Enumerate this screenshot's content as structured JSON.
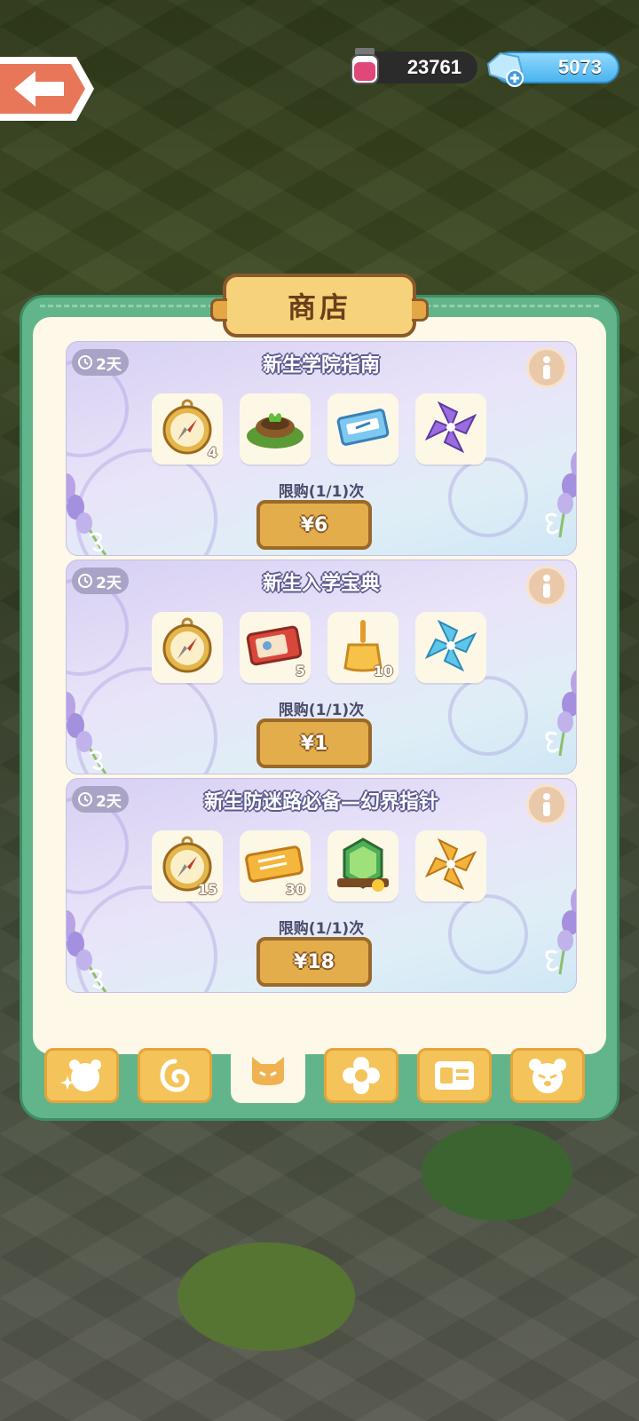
{
  "currencies": {
    "jam": {
      "value": "23761",
      "icon": "jam-jar-icon"
    },
    "gems": {
      "value": "5073",
      "icon": "crystal-icon"
    }
  },
  "shop": {
    "title": "商店",
    "packs": [
      {
        "timer": "2天",
        "title": "新生学院指南",
        "items": [
          {
            "icon": "golden-compass-icon",
            "qty": "4"
          },
          {
            "icon": "plant-pot-icon",
            "qty": ""
          },
          {
            "icon": "blue-ticket-icon",
            "qty": ""
          },
          {
            "icon": "purple-pinwheel-icon",
            "qty": ""
          }
        ],
        "limit": "限购(1/1)次",
        "price": "¥6"
      },
      {
        "timer": "2天",
        "title": "新生入学宝典",
        "items": [
          {
            "icon": "golden-compass-icon",
            "qty": ""
          },
          {
            "icon": "coupon-icon",
            "qty": "5"
          },
          {
            "icon": "brush-icon",
            "qty": "10"
          },
          {
            "icon": "blue-pinwheel-icon",
            "qty": ""
          }
        ],
        "limit": "限购(1/1)次",
        "price": "¥1"
      },
      {
        "timer": "2天",
        "title": "新生防迷路必备—幻界指针",
        "items": [
          {
            "icon": "golden-compass-icon",
            "qty": "15"
          },
          {
            "icon": "gold-ticket-icon",
            "qty": "30"
          },
          {
            "icon": "green-machine-icon",
            "qty": ""
          },
          {
            "icon": "golden-pinwheel-icon",
            "qty": ""
          }
        ],
        "limit": "限购(1/1)次",
        "price": "¥18"
      }
    ]
  },
  "tabs": [
    {
      "icon": "sparkle-bear-icon",
      "active": false
    },
    {
      "icon": "swirl-icon",
      "active": false
    },
    {
      "icon": "cat-icon",
      "active": true
    },
    {
      "icon": "flower-icon",
      "active": false
    },
    {
      "icon": "card-icon",
      "active": false
    },
    {
      "icon": "bear-face-icon",
      "active": false
    }
  ],
  "colors": {
    "panel": "#62b58a",
    "button": "#e4ad4b",
    "title_tab": "#f6d27a"
  }
}
